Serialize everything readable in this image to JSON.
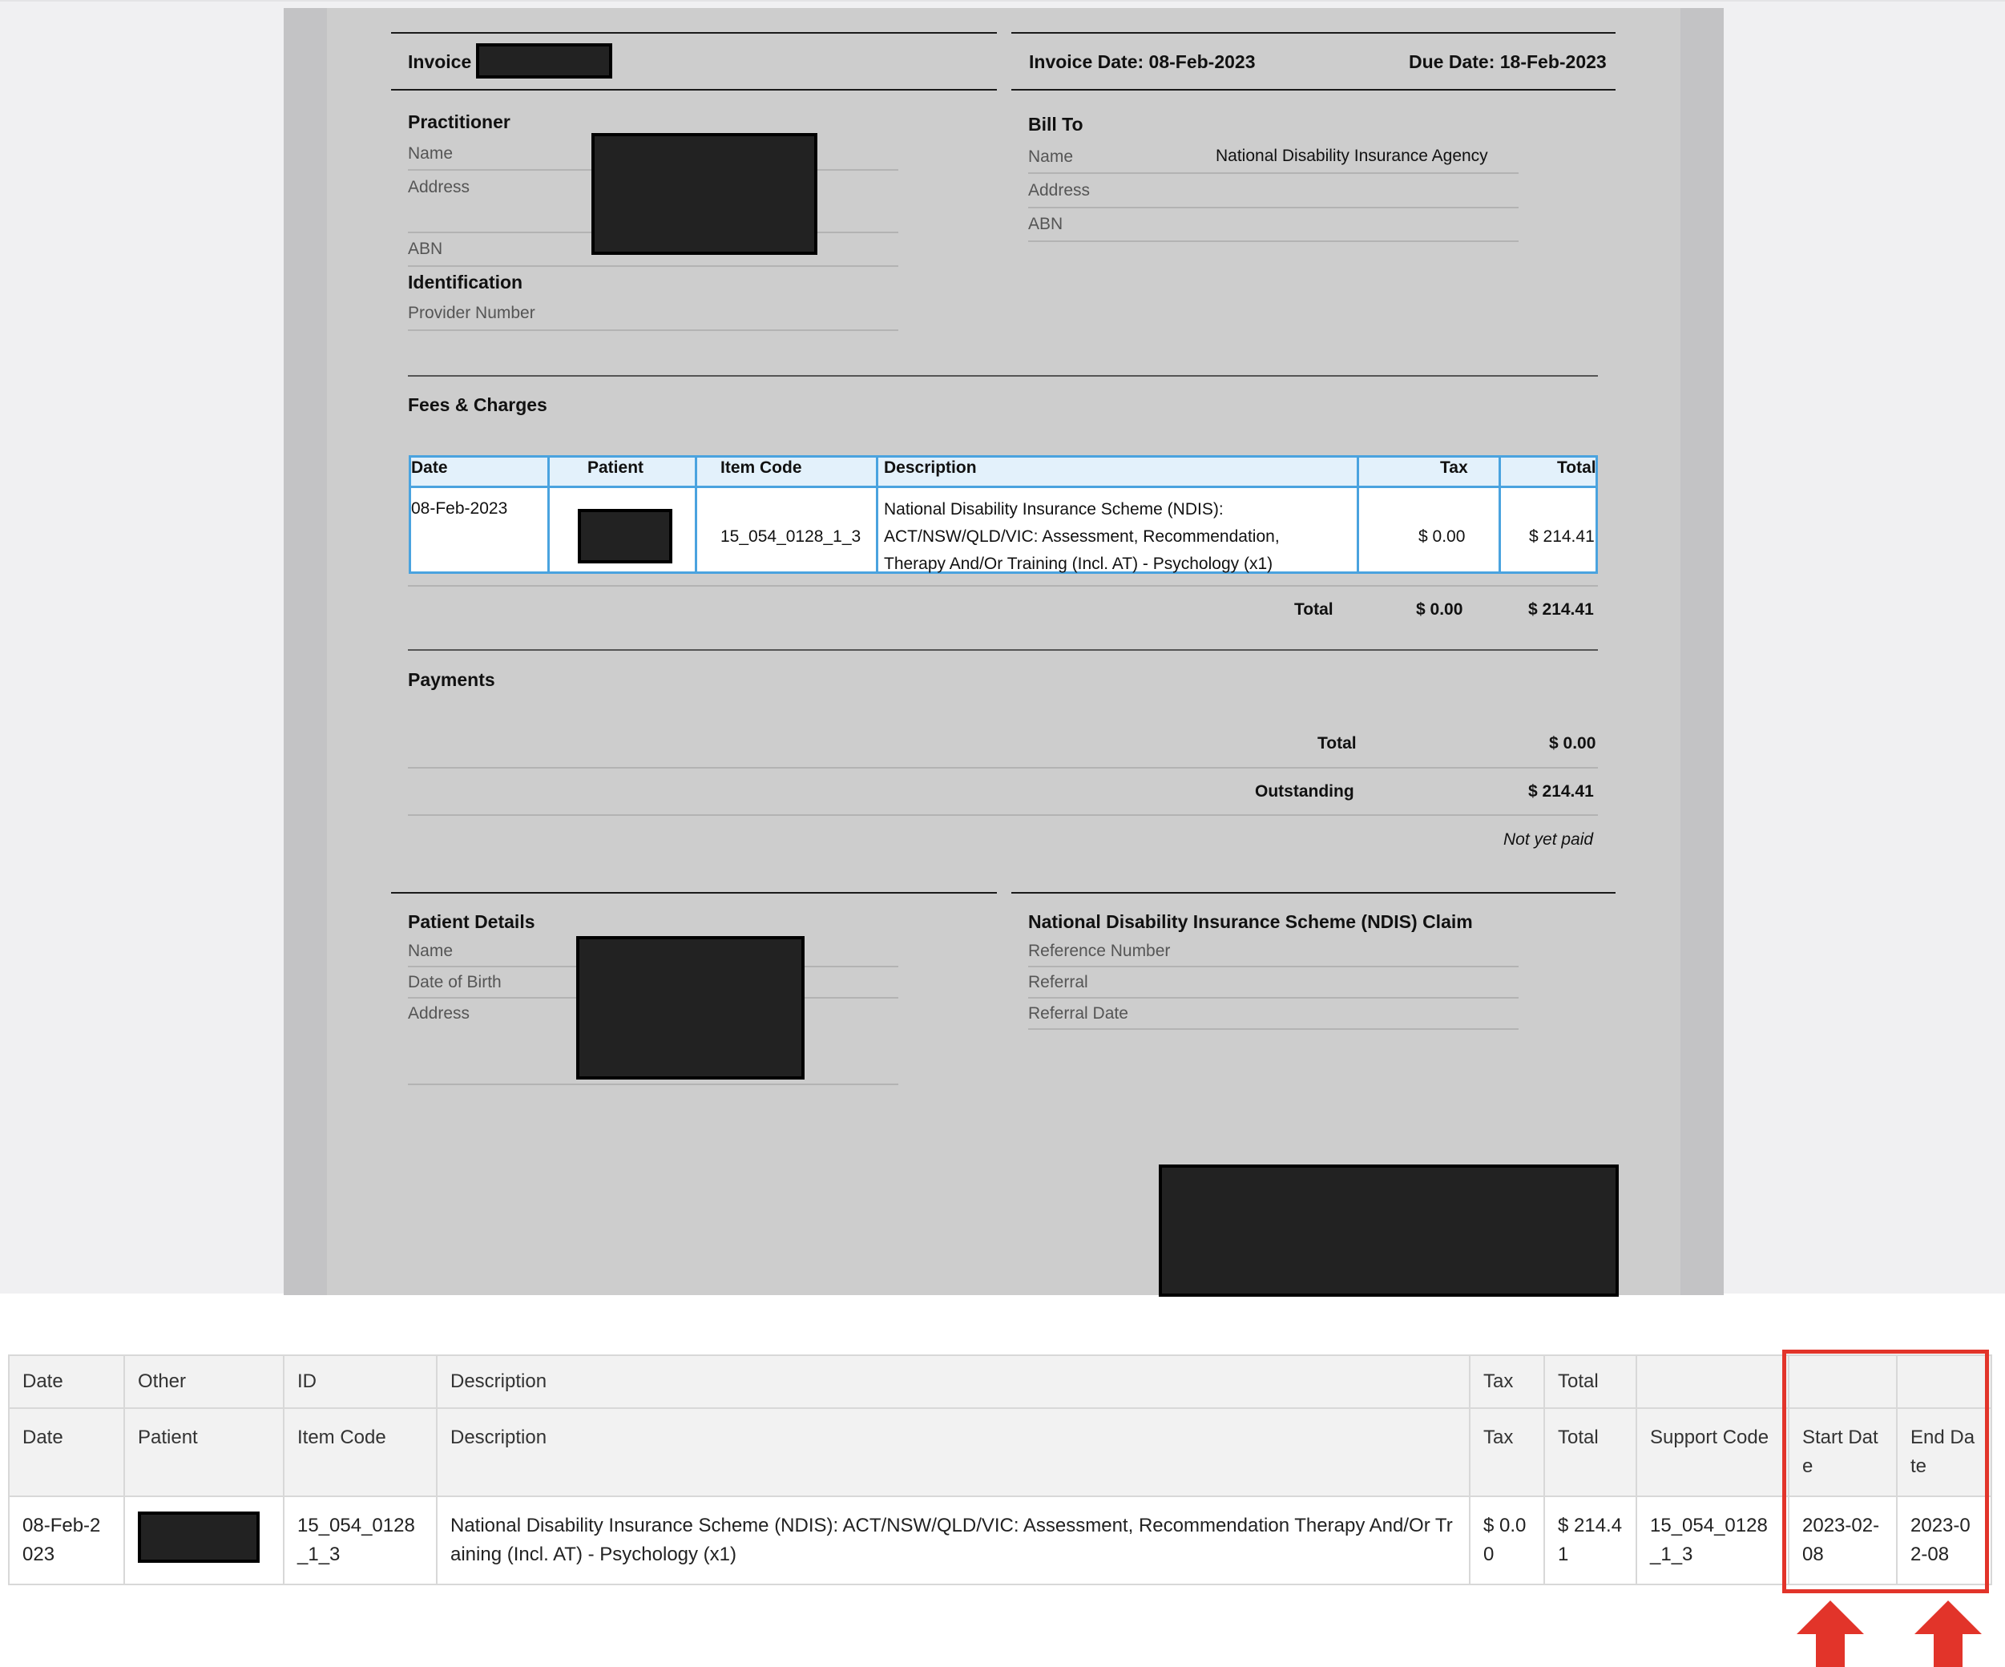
{
  "invoice": {
    "invoice_label": "Invoice",
    "invoice_date": "Invoice Date: 08-Feb-2023",
    "due_date": "Due Date: 18-Feb-2023"
  },
  "practitioner": {
    "heading": "Practitioner",
    "name_label": "Name",
    "address_label": "Address",
    "abn_label": "ABN"
  },
  "identification": {
    "heading": "Identification",
    "provider_label": "Provider Number"
  },
  "bill_to": {
    "heading": "Bill To",
    "name_label": "Name",
    "name_value": "National Disability Insurance Agency",
    "address_label": "Address",
    "abn_label": "ABN"
  },
  "fees": {
    "heading": "Fees & Charges",
    "columns": [
      "Date",
      "Patient",
      "Item Code",
      "Description",
      "Tax",
      "Total"
    ],
    "row": {
      "date": "08-Feb-2023",
      "item_code": "15_054_0128_1_3",
      "desc_line1": "National Disability Insurance Scheme (NDIS):",
      "desc_line2": "ACT/NSW/QLD/VIC: Assessment, Recommendation,",
      "desc_line3": "Therapy And/Or Training (Incl. AT) - Psychology (x1)",
      "tax": "$ 0.00",
      "total": "$ 214.41"
    },
    "total_label": "Total",
    "total_tax": "$ 0.00",
    "total_total": "$ 214.41"
  },
  "payments": {
    "heading": "Payments",
    "total_label": "Total",
    "total_value": "$ 0.00",
    "outstanding_label": "Outstanding",
    "outstanding_value": "$ 214.41",
    "status": "Not yet paid"
  },
  "patient_details": {
    "heading": "Patient Details",
    "name_label": "Name",
    "dob_label": "Date of Birth",
    "address_label": "Address"
  },
  "ndis_claim": {
    "heading": "National Disability Insurance Scheme (NDIS) Claim",
    "reference_label": "Reference Number",
    "referral_label": "Referral",
    "referral_date_label": "Referral Date"
  },
  "grid": {
    "row1": [
      "Date",
      "Other",
      "ID",
      "Description",
      "Tax",
      "Total",
      "",
      "",
      ""
    ],
    "row2": [
      "Date",
      "Patient",
      "Item Code",
      "Description",
      "Tax",
      "Total",
      "Support Code",
      "Start Date",
      "End Date"
    ],
    "row3": {
      "date": "08-Feb-2023",
      "id": "15_054_0128_1_3",
      "description": "National Disability Insurance Scheme (NDIS): ACT/NSW/QLD/VIC: Assessment, Recommendation Therapy And/Or Training (Incl. AT) - Psychology (x1)",
      "tax": "$ 0.00",
      "total": "$ 214.41",
      "support_code": "15_054_0128_1_3",
      "start_date": "2023-02-08",
      "end_date": "2023-02-08"
    }
  },
  "colors": {
    "highlight": "#e2342a",
    "table_border": "#4aa3df",
    "table_header": "#e3f1fb"
  }
}
